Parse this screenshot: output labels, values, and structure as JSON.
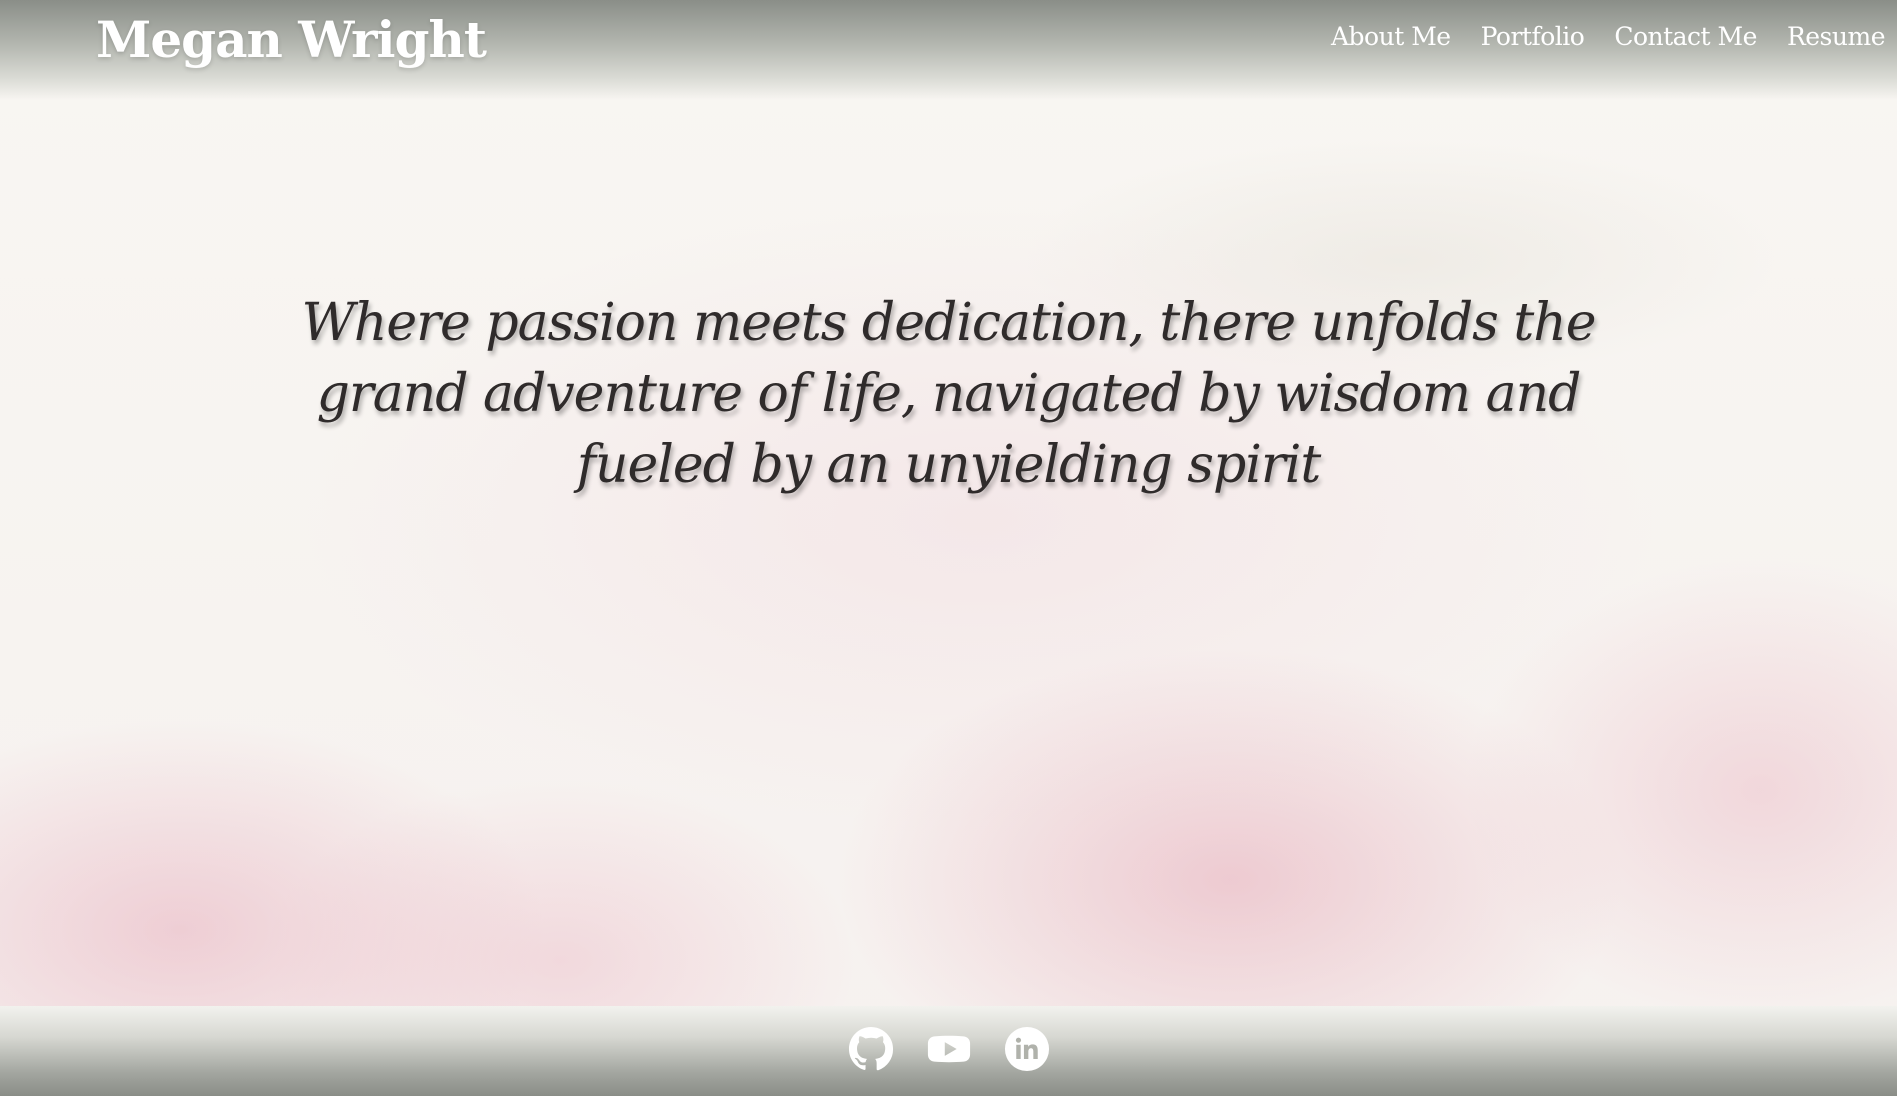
{
  "header": {
    "brand": "Megan Wright",
    "nav": [
      "About Me",
      "Portfolio",
      "Contact Me",
      "Resume"
    ]
  },
  "hero": {
    "quote": "Where passion meets dedication, there unfolds the grand adventure of life, navigated by wisdom and fueled by an unyielding spirit"
  },
  "footer": {
    "social_icons": [
      "github-icon",
      "youtube-icon",
      "linkedin-icon"
    ]
  },
  "colors": {
    "header_gray": "#8a8e88",
    "text_white": "#ffffff",
    "quote_text": "#2f2b2b",
    "watercolor_pink": "#e8b0be"
  }
}
